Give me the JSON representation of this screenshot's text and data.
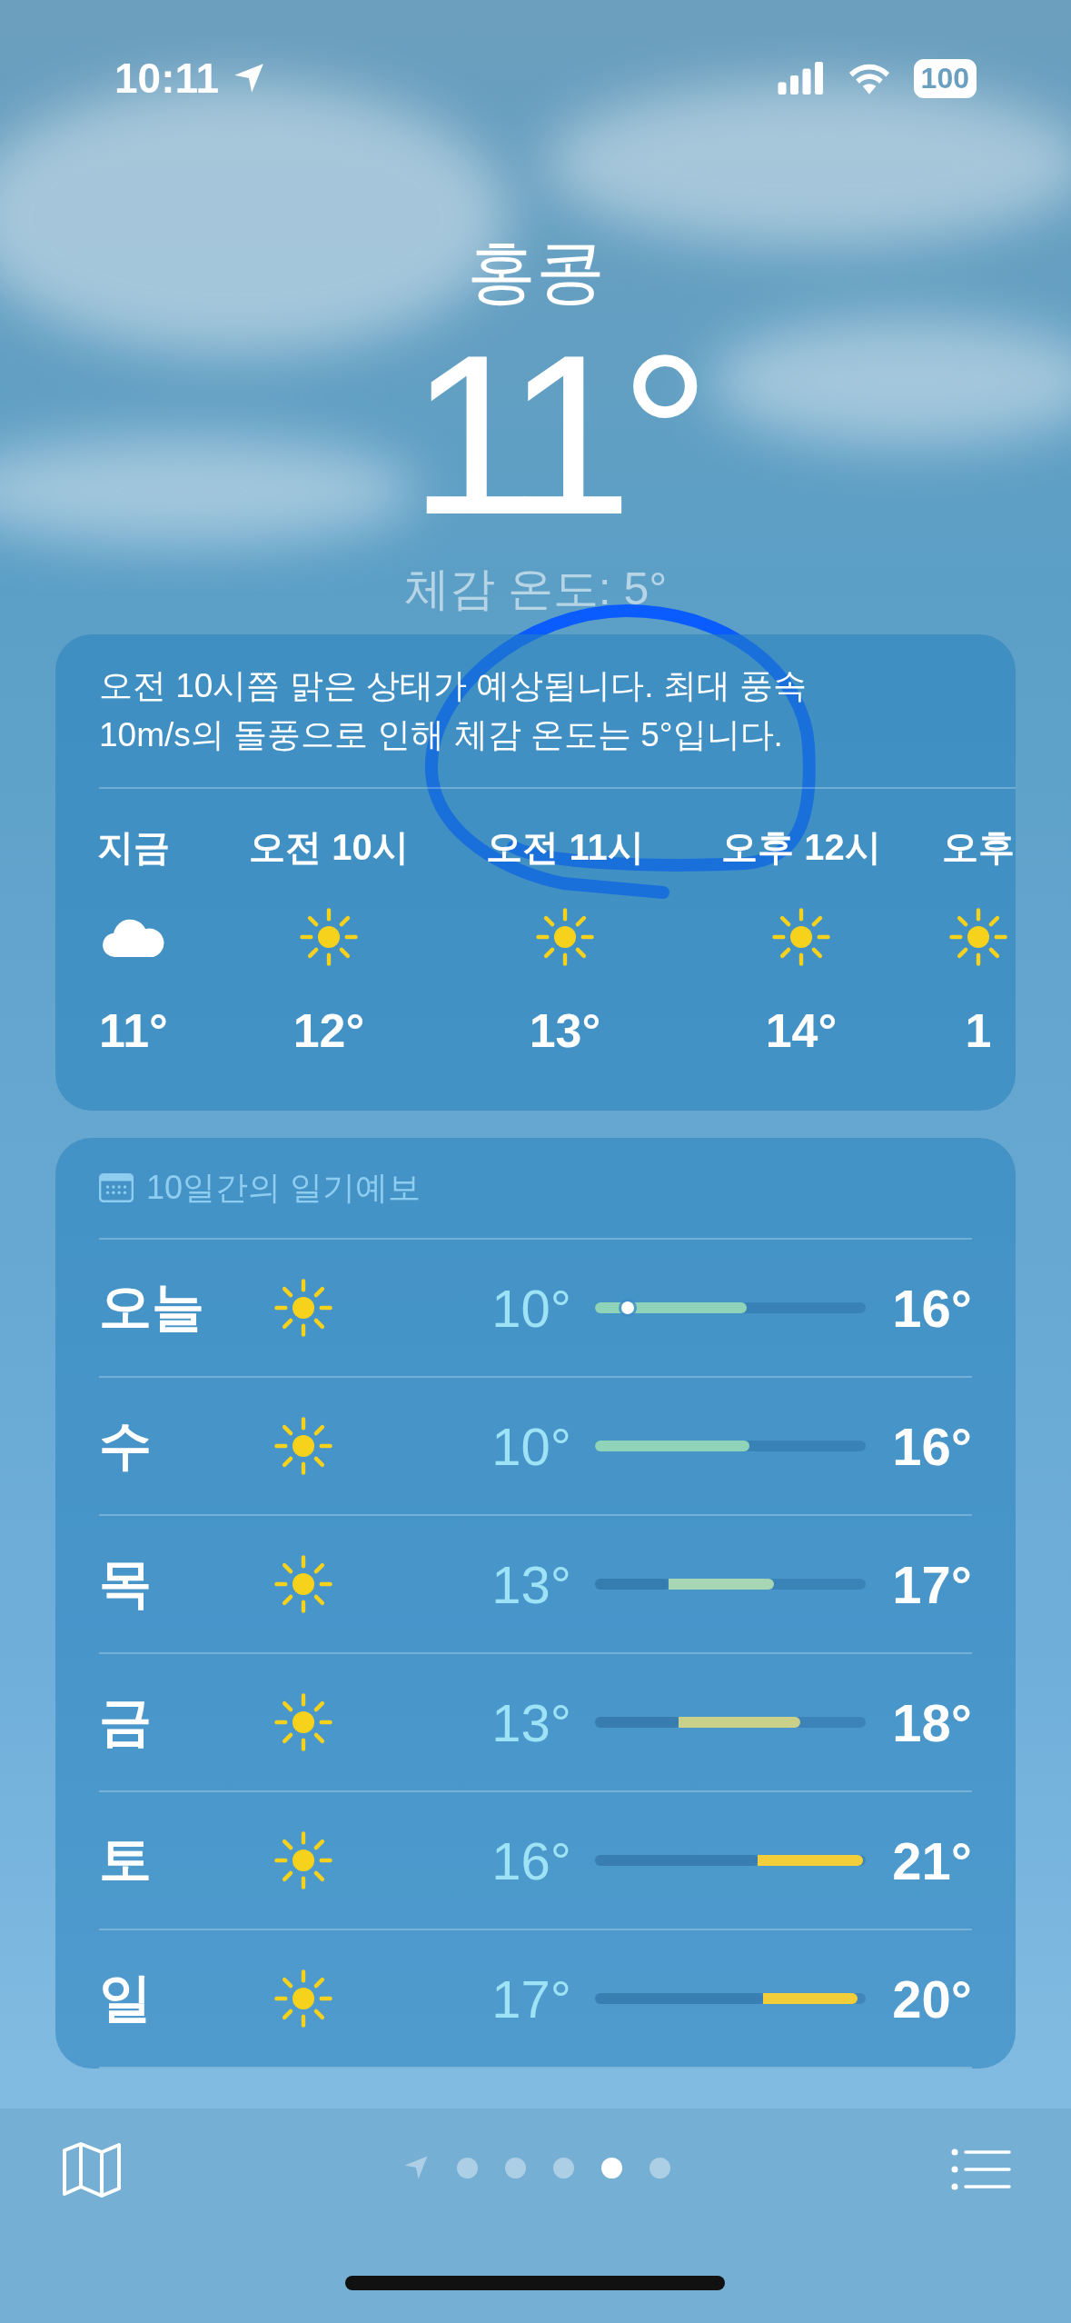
{
  "status_bar": {
    "time": "10:11",
    "battery": "100"
  },
  "header": {
    "city": "홍콩",
    "temperature": "11°",
    "feels_like": "체감 온도: 5°"
  },
  "hourly_card": {
    "summary": "오전 10시쯤 맑은 상태가 예상됩니다. 최대 풍속 10m/s의 돌풍으로 인해 체감 온도는 5°입니다.",
    "hours": [
      {
        "label": "지금",
        "kind": "cloud",
        "temp": "11°"
      },
      {
        "label": "오전 10시",
        "kind": "sun",
        "temp": "12°"
      },
      {
        "label": "오전 11시",
        "kind": "sun",
        "temp": "13°"
      },
      {
        "label": "오후 12시",
        "kind": "sun",
        "temp": "14°"
      },
      {
        "label": "오후",
        "kind": "sun",
        "temp": "1"
      }
    ]
  },
  "daily_card": {
    "title": "10일간의 일기예보",
    "days": [
      {
        "day": "오늘",
        "kind": "sun",
        "low": "10°",
        "high": "16°",
        "bar_end": {
          "level": 0.56
        },
        "current": {
          "level": 0.12
        },
        "color": "#8fd3b8"
      },
      {
        "day": "수",
        "kind": "sun",
        "low": "10°",
        "high": "16°",
        "bar_end": {
          "level": 0.57
        },
        "color": "#8fd3b8"
      },
      {
        "day": "목",
        "kind": "sun",
        "low": "13°",
        "high": "17°",
        "bar_start": {
          "level": 0.27
        },
        "bar_end": {
          "level": 0.66
        },
        "color": "#a6d6b4"
      },
      {
        "day": "금",
        "kind": "sun",
        "low": "13°",
        "high": "18°",
        "bar_start": {
          "level": 0.31
        },
        "bar_end": {
          "level": 0.76
        },
        "color": "#c9d08a"
      },
      {
        "day": "토",
        "kind": "sun",
        "low": "16°",
        "high": "21°",
        "bar_start": {
          "level": 0.6
        },
        "bar_end": {
          "level": 0.99
        },
        "color": "#f2cf3a"
      },
      {
        "day": "일",
        "kind": "sun",
        "low": "17°",
        "high": "20°",
        "bar_start": {
          "level": 0.62
        },
        "bar_end": {
          "level": 0.97
        },
        "color": "#f2cf3a"
      }
    ]
  },
  "page_dots": [
    {
      "kind": "location",
      "selected": false
    },
    {
      "kind": "dot",
      "selected": false
    },
    {
      "kind": "dot",
      "selected": false
    },
    {
      "kind": "dot",
      "selected": false
    },
    {
      "kind": "dot",
      "selected": true
    },
    {
      "kind": "dot",
      "selected": false
    }
  ]
}
